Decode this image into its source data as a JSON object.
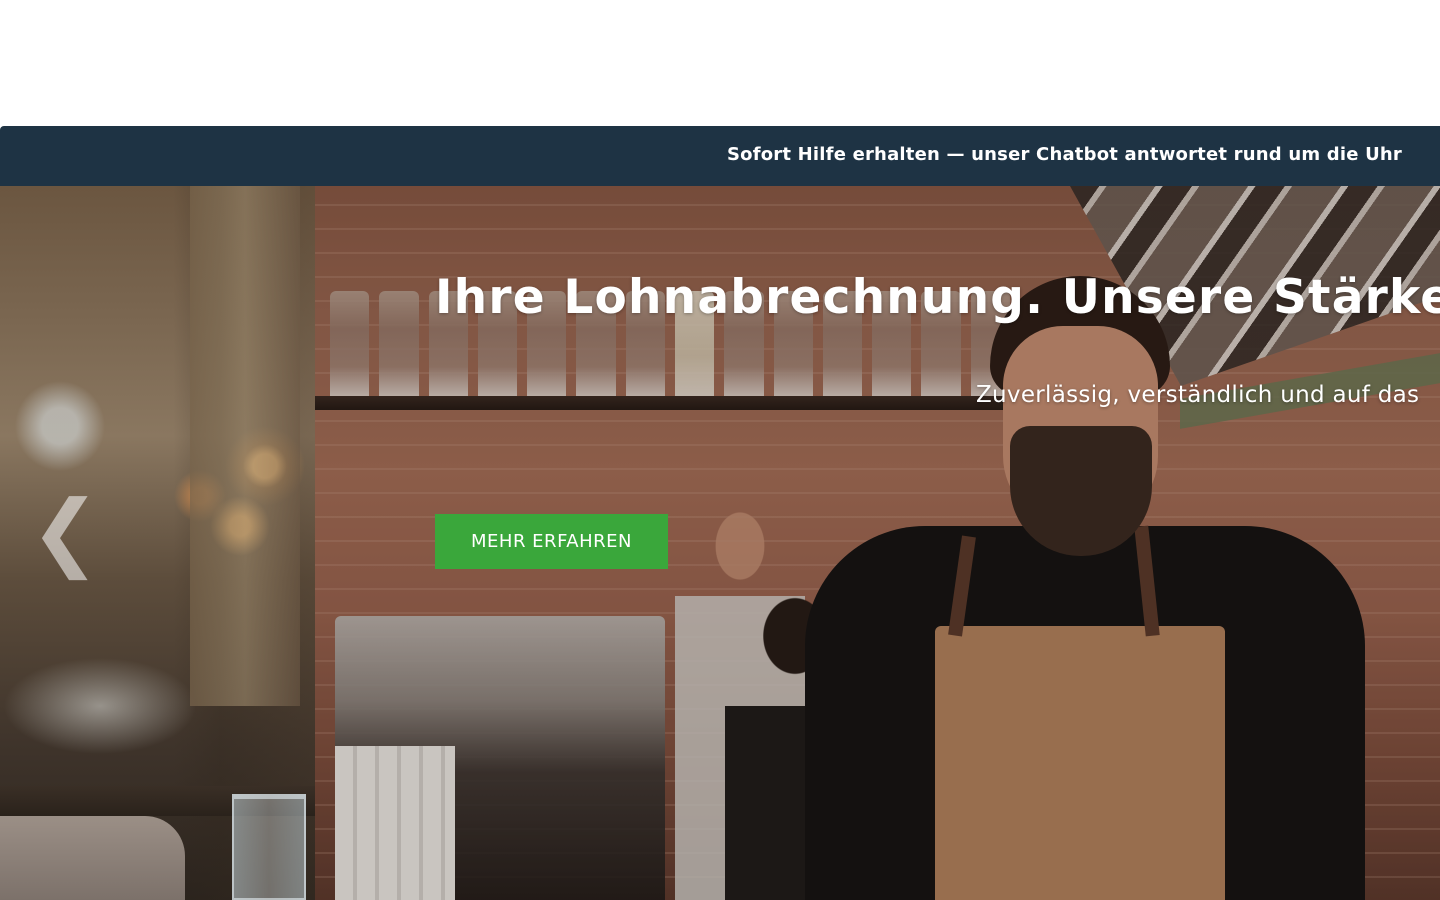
{
  "info_bar": {
    "text": "Sofort Hilfe erhalten — unser Chatbot antwortet rund um die Uhr"
  },
  "hero": {
    "title": "Ihre Lohnabrechnung. Unsere Stärke",
    "subtitle": "Zuverlässig, verständlich und auf das",
    "cta_label": "MEHR ERFAHREN",
    "prev_arrow": "❮"
  },
  "colors": {
    "info_bar_bg": "#1e3344",
    "cta_bg": "#3aa73b",
    "text": "#ffffff"
  },
  "icons": {
    "prev_arrow": "chevron-left-icon"
  }
}
